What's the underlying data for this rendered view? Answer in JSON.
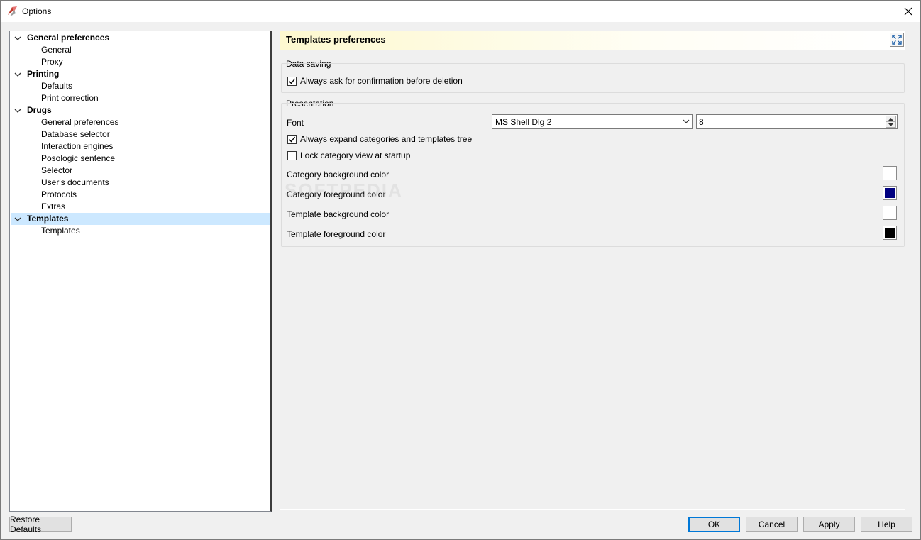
{
  "window": {
    "title": "Options"
  },
  "tree": [
    {
      "label": "General preferences",
      "level": 0,
      "expanded": true
    },
    {
      "label": "General",
      "level": 1
    },
    {
      "label": "Proxy",
      "level": 1
    },
    {
      "label": "Printing",
      "level": 0,
      "expanded": true
    },
    {
      "label": "Defaults",
      "level": 1
    },
    {
      "label": "Print correction",
      "level": 1
    },
    {
      "label": "Drugs",
      "level": 0,
      "expanded": true
    },
    {
      "label": "General preferences",
      "level": 1
    },
    {
      "label": "Database selector",
      "level": 1
    },
    {
      "label": "Interaction engines",
      "level": 1
    },
    {
      "label": "Posologic sentence",
      "level": 1
    },
    {
      "label": "Selector",
      "level": 1
    },
    {
      "label": "User's documents",
      "level": 1
    },
    {
      "label": "Protocols",
      "level": 1
    },
    {
      "label": "Extras",
      "level": 1
    },
    {
      "label": "Templates",
      "level": 0,
      "expanded": true,
      "selected": true
    },
    {
      "label": "Templates",
      "level": 1
    }
  ],
  "panel": {
    "title": "Templates preferences",
    "data_saving": {
      "title": "Data saving",
      "confirm_delete": {
        "label": "Always ask for confirmation before deletion",
        "checked": true
      }
    },
    "presentation": {
      "title": "Presentation",
      "font_label": "Font",
      "font_value": "MS Shell Dlg 2",
      "font_size": "8",
      "expand_tree": {
        "label": "Always expand categories and templates tree",
        "checked": true
      },
      "lock_view": {
        "label": "Lock category view at startup",
        "checked": false
      },
      "colors": [
        {
          "label": "Category background color",
          "color": "#ffffff"
        },
        {
          "label": "Category foreground color",
          "color": "#000080"
        },
        {
          "label": "Template background color",
          "color": "#ffffff"
        },
        {
          "label": "Template foreground color",
          "color": "#000000"
        }
      ]
    }
  },
  "buttons": {
    "restore": "Restore Defaults",
    "ok": "OK",
    "cancel": "Cancel",
    "apply": "Apply",
    "help": "Help"
  },
  "watermark": "SOFTPEDIA"
}
